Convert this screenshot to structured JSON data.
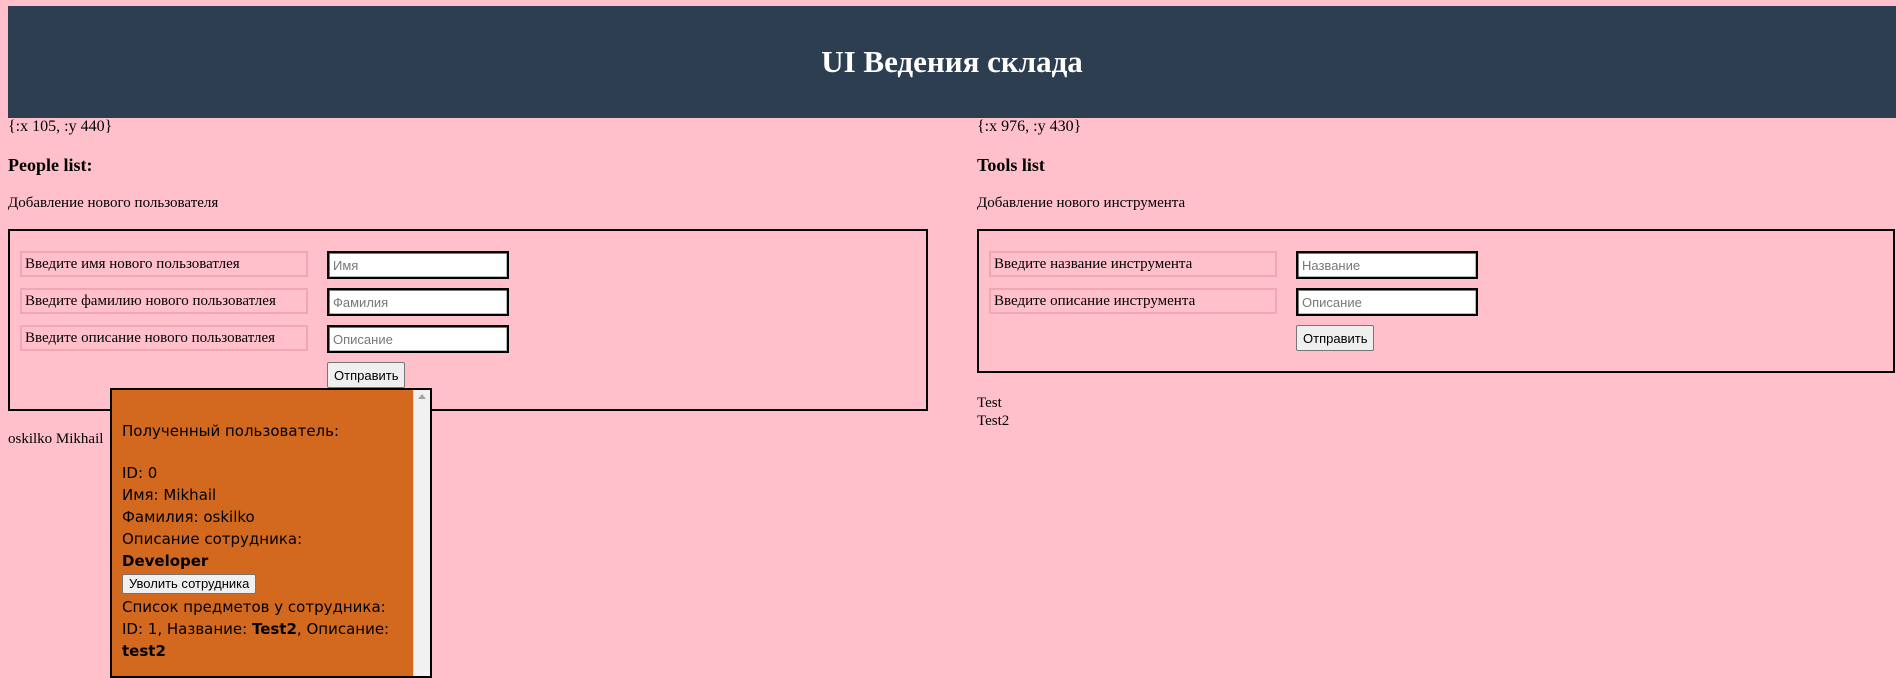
{
  "header": {
    "title": "UI Ведения склада"
  },
  "people": {
    "coords": "{:x 105, :y 440}",
    "title": "People list:",
    "subtitle": "Добавление нового пользователя",
    "form": {
      "first_name_label": "Введите имя нового пользоватлея",
      "first_name_placeholder": "Имя",
      "last_name_label": "Введите фамилию нового пользоватлея",
      "last_name_placeholder": "Фамилия",
      "description_label": "Введите описание нового пользоватлея",
      "description_placeholder": "Описание",
      "submit_label": "Отправить"
    },
    "list_item": "oskilko Mikhail"
  },
  "tools": {
    "coords": "{:x 976, :y 430}",
    "title": "Tools list",
    "subtitle": "Добавление нового инструмента",
    "form": {
      "name_label": "Введите название инструмента",
      "name_placeholder": "Название",
      "description_label": "Введите описание инструмента",
      "description_placeholder": "Описание",
      "submit_label": "Отправить"
    },
    "items": [
      "Test",
      "Test2"
    ]
  },
  "popup": {
    "heading": "Полученный пользователь:",
    "id_label": "ID: ",
    "id_value": "0",
    "name_label": "Имя: ",
    "name_value": "Mikhail",
    "surname_label": "Фамилия: ",
    "surname_value": "oskilko",
    "desc_label": "Описание сотрудника: ",
    "desc_value": "Developer",
    "fire_button": "Уволить сотрудника",
    "items_heading": "Список предметов у сотрудника:",
    "item_id_label": "ID: ",
    "item_id_value": "1",
    "item_name_label": ", Название: ",
    "item_name_value": "Test2",
    "item_desc_label": ", Описание: ",
    "item_desc_value": "test2"
  },
  "colors": {
    "background": "#ffc0cb",
    "header": "#2c3e50",
    "popup": "#d2691e"
  }
}
